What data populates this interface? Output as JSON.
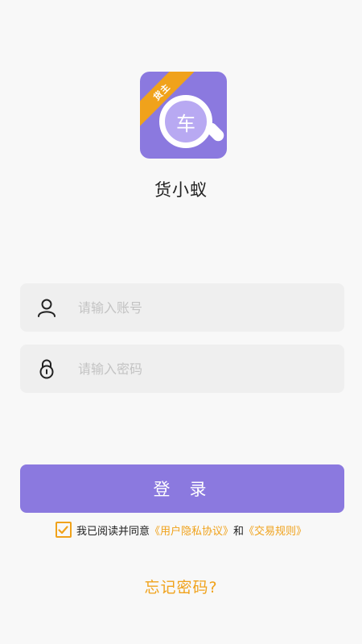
{
  "logo": {
    "ribbon_text": "货主",
    "lens_char": "车"
  },
  "app_name": "货小蚁",
  "account": {
    "placeholder": "请输入账号",
    "icon": "user-icon"
  },
  "password": {
    "placeholder": "请输入密码",
    "icon": "lock-icon"
  },
  "login_label": "登录",
  "agreement": {
    "checked": true,
    "text_prefix": "我已阅读并同意",
    "privacy_link": "《用户隐私协议》",
    "and_text": "和",
    "rules_link": "《交易规则》"
  },
  "forgot_label": "忘记密码?",
  "colors": {
    "brand": "#8b79df",
    "accent": "#f0a21b",
    "field_bg": "#efefef",
    "bg": "#f8f8f8"
  }
}
